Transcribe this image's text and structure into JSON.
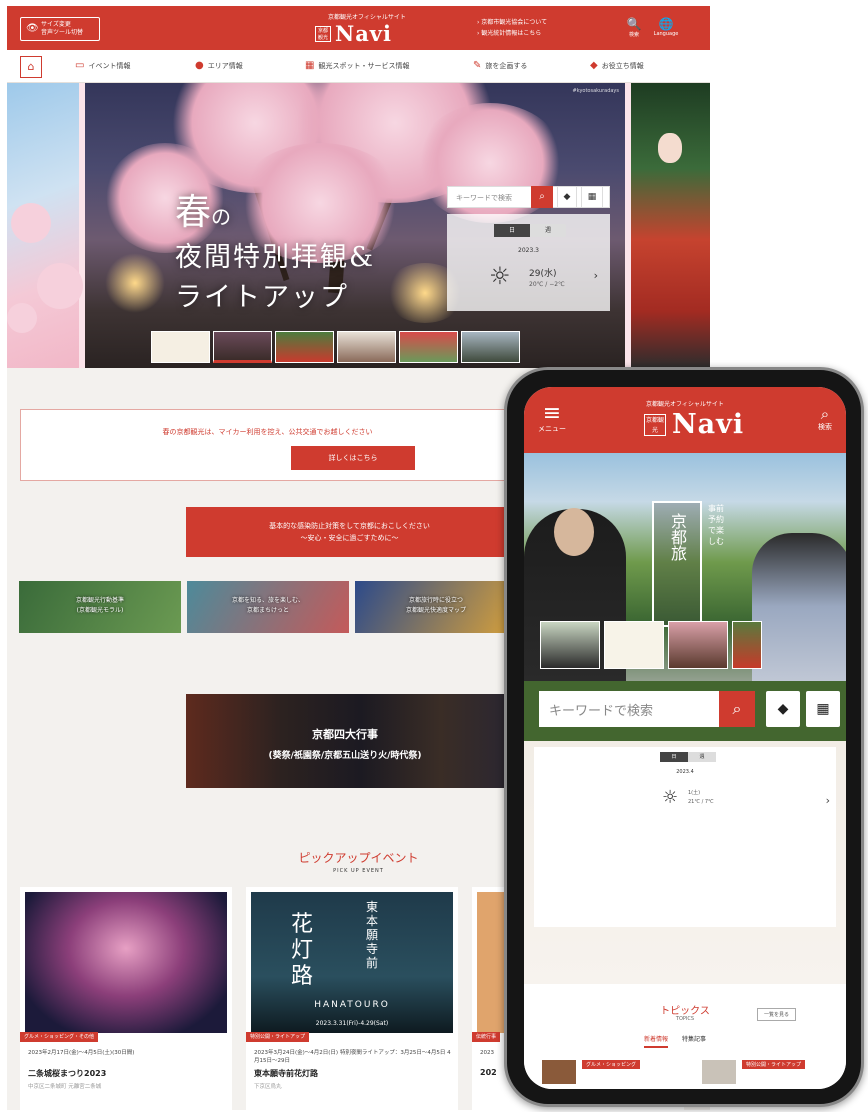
{
  "desktop": {
    "header": {
      "size_box_line1": "サイズ変更",
      "size_box_line2": "音声ツール切替",
      "site_subtitle": "京都観光オフィシャルサイト",
      "seal_text": "京都観光",
      "logo": "Navi",
      "link1": "› 京都市観光協会について",
      "link2": "› 観光統計情報はこちら",
      "search_label": "検索",
      "language_label": "Language",
      "brand_color": "#cf3b2f"
    },
    "nav": {
      "items": [
        {
          "icon": "calendar-icon",
          "label": "イベント情報"
        },
        {
          "icon": "pin-icon",
          "label": "エリア情報"
        },
        {
          "icon": "grid-icon",
          "label": "観光スポット・サービス情報"
        },
        {
          "icon": "pencil-icon",
          "label": "旅を企画する"
        },
        {
          "icon": "gift-icon",
          "label": "お役立ち情報"
        }
      ]
    },
    "hero": {
      "title_part1": "春",
      "title_part2": "の",
      "title_line2": "夜間特別拝観&",
      "title_line3": "ライトアップ",
      "photo_tag": "#kyotosakuradays",
      "search_placeholder": "キーワードで検索",
      "weather_toggle": [
        "日",
        "週"
      ],
      "weather_year": "2023.3",
      "weather_day": "29(水)",
      "weather_temp": "20℃ / −2℃"
    },
    "notice": {
      "text": "春の京都観光は、マイカー利用を控え、公共交通でお越しください",
      "button": "詳しくはこちら"
    },
    "banner": {
      "line1": "基本的な感染防止対策をして京都におこしください",
      "line2": "〜安心・安全に過ごすために〜"
    },
    "tiles": [
      {
        "line1": "京都観光行動基準",
        "line2": "(京都観光モラル)"
      },
      {
        "line1": "京都を知る、旅を楽しむ、",
        "line2": "京都まちけっと"
      },
      {
        "line1": "京都旅行時に役立つ",
        "line2": "京都観光快適度マップ"
      }
    ],
    "matsuri": {
      "title": "京都四大行事",
      "subtitle": "(葵祭/祇園祭/京都五山送り火/時代祭)"
    },
    "pickup": {
      "title": "ピックアップイベント",
      "subtitle": "PICK UP EVENT",
      "events": [
        {
          "label": "グルメ・ショッピング・その他",
          "date": "2023年2月17日(金)〜4月5日(土)(30日間)",
          "name": "二条城桜まつり2023",
          "place": "中京区二条城町 元離宮二条城"
        },
        {
          "label": "特別公開・ライトアップ",
          "date": "2023年3月24日(金)〜4月2日(日) 特別夜間ライトアップ：3月25日〜4月5日 4月15日〜29日",
          "name": "東本願寺前花灯路",
          "place": "下京区烏丸"
        },
        {
          "label": "伝統行事",
          "date": "2023",
          "name": "202",
          "place": ""
        }
      ],
      "poster_text": "花灯路",
      "poster_sub": "東本願寺前",
      "poster_en": "HANATOURO",
      "poster_date": "2023.3.31(Fri)-4.29(Sat)"
    }
  },
  "phone": {
    "header": {
      "menu_label": "メニュー",
      "site_subtitle": "京都観光オフィシャルサイト",
      "seal_text": "京都観光",
      "logo": "Navi",
      "search_label": "検索"
    },
    "hero": {
      "vertical_title": "京都旅",
      "vertical_sub": "事前予約で楽しむ"
    },
    "search_placeholder": "キーワードで検索",
    "weather": {
      "toggle": [
        "日",
        "週"
      ],
      "year": "2023.4",
      "day": "1(土)",
      "temp": "21℃ / 7℃"
    },
    "topics": {
      "title": "トピックス",
      "subtitle": "TOPICS",
      "more": "一覧を見る",
      "tabs": [
        "新着情報",
        "特集記事"
      ],
      "badges": [
        "グルメ・ショッピング",
        "特別公開・ライトアップ"
      ]
    }
  }
}
